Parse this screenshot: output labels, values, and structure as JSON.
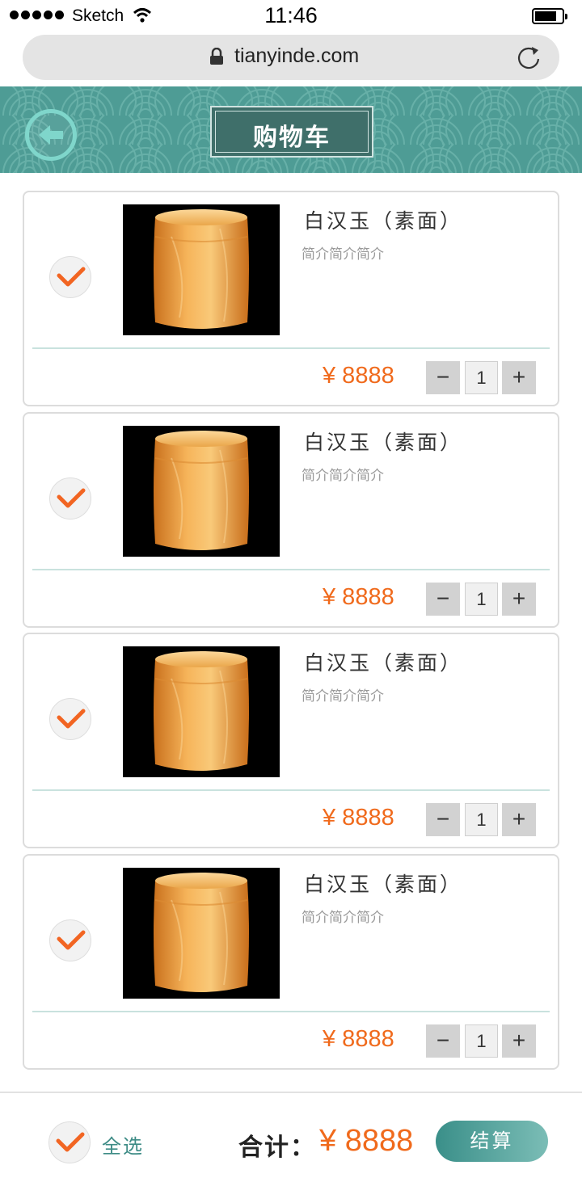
{
  "status_bar": {
    "carrier": "Sketch",
    "time": "11:46"
  },
  "browser": {
    "url": "tianyinde.com"
  },
  "header": {
    "title": "购物车"
  },
  "cart": {
    "items": [
      {
        "name": "白汉玉（素面）",
        "desc": "简介简介简介",
        "price": "¥ 8888",
        "qty": "1",
        "minus": "−",
        "plus": "+"
      },
      {
        "name": "白汉玉（素面）",
        "desc": "简介简介简介",
        "price": "¥ 8888",
        "qty": "1",
        "minus": "−",
        "plus": "+"
      },
      {
        "name": "白汉玉（素面）",
        "desc": "简介简介简介",
        "price": "¥ 8888",
        "qty": "1",
        "minus": "−",
        "plus": "+"
      },
      {
        "name": "白汉玉（素面）",
        "desc": "简介简介简介",
        "price": "¥ 8888",
        "qty": "1",
        "minus": "−",
        "plus": "+"
      }
    ]
  },
  "footer": {
    "select_all": "全选",
    "total_label": "合计：",
    "total_value": "¥ 8888",
    "checkout": "结算"
  },
  "colors": {
    "accent": "#f06a1c",
    "teal": "#4e9c95",
    "check": "#f26522"
  }
}
